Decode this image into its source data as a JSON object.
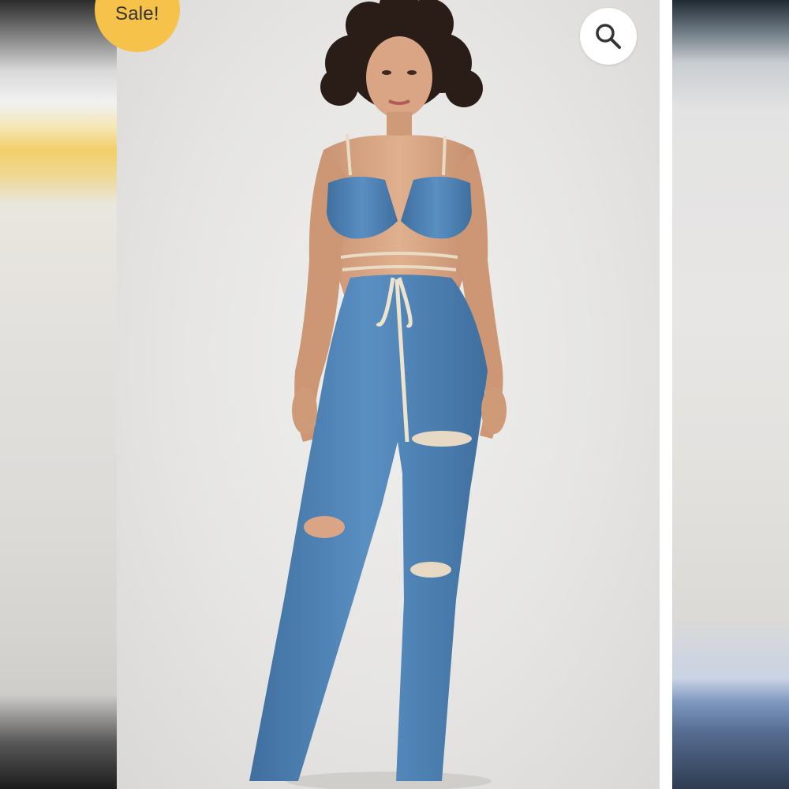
{
  "badge": {
    "label": "Sale!",
    "color": "#f7c24a"
  },
  "search": {
    "icon": "search-icon",
    "background": "#ffffff"
  },
  "gallery": {
    "main_image": "model-in-denim-outfit-photo",
    "prev_image": "blurred-previous-photo",
    "next_image": "blurred-next-photo"
  },
  "colors": {
    "denim": "#4a7fb5",
    "rope": "#e8dcc4",
    "backdrop": "#e6e5e3"
  }
}
